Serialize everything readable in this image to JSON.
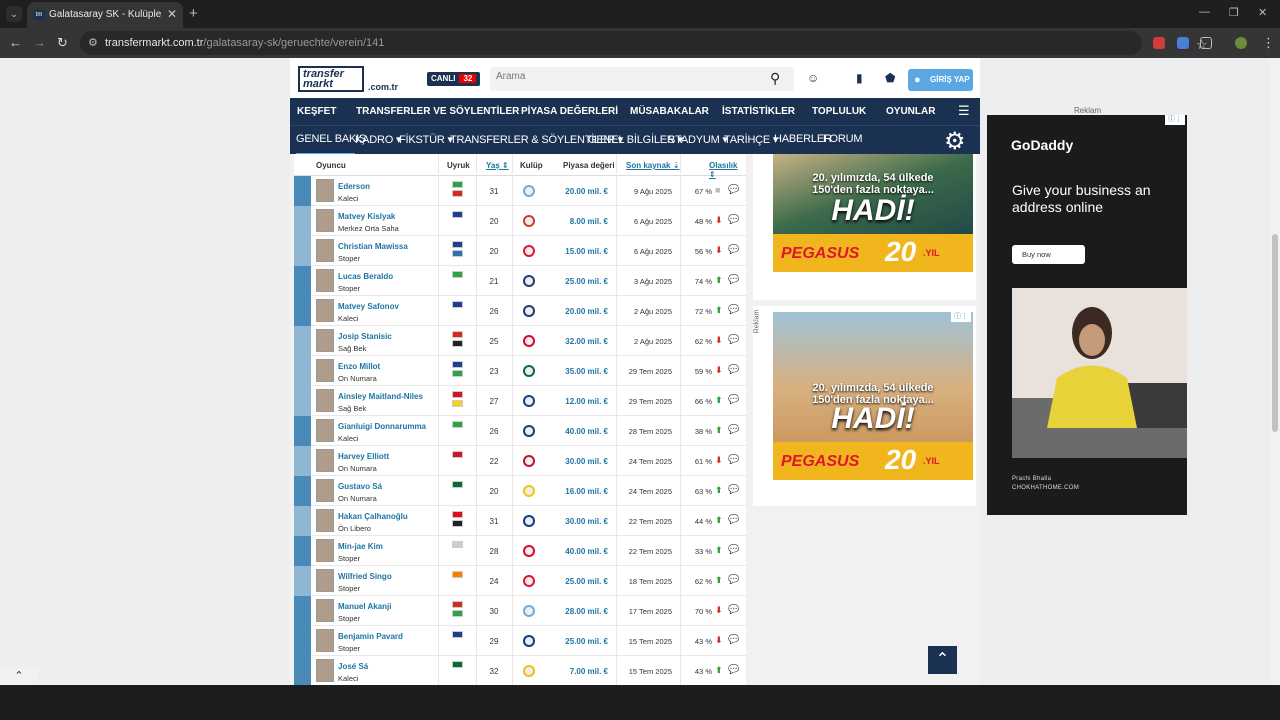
{
  "browser": {
    "tab_title": "Galatasaray SK - Kulüple ilgili tr",
    "url_domain": "transfermarkt.com.tr",
    "url_path": "/galatasaray-sk/geruechte/verein/141"
  },
  "header": {
    "logo_text": "transfer markt",
    "logo_sub": ".com.tr",
    "live_label": "CANLI",
    "live_count": "32",
    "search_placeholder": "Arama",
    "login_label": "GİRİŞ YAP"
  },
  "nav_main": [
    "KEŞFET",
    "TRANSFERLER VE SÖYLENTİLER",
    "PİYASA DEĞERLERİ",
    "MÜSABAKALAR",
    "İSTATİSTİKLER",
    "TOPLULUK",
    "OYUNLAR"
  ],
  "nav_sub": [
    "GENEL BAKIŞ",
    "KADRO ▾",
    "FİKSTÜR ▾",
    "TRANSFERLER & SÖYLENTİLER ▾",
    "GENEL BİLGİLER ▾",
    "STADYUM ▾",
    "TARİHÇE ▾",
    "HABERLER",
    "FORUM"
  ],
  "table": {
    "headers": {
      "player": "Oyuncu",
      "nationality": "Uyruk",
      "age": "Yaş ⇕",
      "club": "Kulüp",
      "market_value": "Piyasa değeri",
      "last_source": "Son kaynak ⇣",
      "probability": "Olasılık ⇕"
    },
    "rows": [
      {
        "name": "Ederson",
        "pos": "Kaleci",
        "age": "31",
        "value": "20.00 mil. €",
        "date": "9 Ağu 2025",
        "pct": "67 %",
        "trend": "■",
        "trend_color": "#bbbbbb",
        "flags": [
          "#2ba543",
          "#d52b1e"
        ],
        "bar": "#4a8ab8",
        "club_color": "#6caddf"
      },
      {
        "name": "Matvey Kislyak",
        "pos": "Merkez Orta Saha",
        "age": "20",
        "value": "8.00 mil. €",
        "date": "6 Ağu 2025",
        "pct": "48 %",
        "trend": "⬇",
        "trend_color": "#d02b2b",
        "flags": [
          "#1c3f94"
        ],
        "bar": "#8fb6d3",
        "club_color": "#d03c2c"
      },
      {
        "name": "Christian Mawissa",
        "pos": "Stoper",
        "age": "20",
        "value": "15.00 mil. €",
        "date": "6 Ağu 2025",
        "pct": "56 %",
        "trend": "⬇",
        "trend_color": "#d02b2b",
        "flags": [
          "#1c3f94",
          "#2f6fb0"
        ],
        "bar": "#8fb6d3",
        "club_color": "#e3142c"
      },
      {
        "name": "Lucas Beraldo",
        "pos": "Stoper",
        "age": "21",
        "value": "25.00 mil. €",
        "date": "3 Ağu 2025",
        "pct": "74 %",
        "trend": "⬆",
        "trend_color": "#2e9e3a",
        "flags": [
          "#2ba543"
        ],
        "bar": "#4a8ab8",
        "club_color": "#1b3c78"
      },
      {
        "name": "Matvey Safonov",
        "pos": "Kaleci",
        "age": "26",
        "value": "20.00 mil. €",
        "date": "2 Ağu 2025",
        "pct": "72 %",
        "trend": "⬆",
        "trend_color": "#2e9e3a",
        "flags": [
          "#1c3f94"
        ],
        "bar": "#4a8ab8",
        "club_color": "#1b3c78"
      },
      {
        "name": "Josip Stanisic",
        "pos": "Sağ Bek",
        "age": "25",
        "value": "32.00 mil. €",
        "date": "2 Ağu 2025",
        "pct": "62 %",
        "trend": "⬇",
        "trend_color": "#d02b2b",
        "flags": [
          "#d52b1e",
          "#222222"
        ],
        "bar": "#8fb6d3",
        "club_color": "#dc052d"
      },
      {
        "name": "Enzo Millot",
        "pos": "On Numara",
        "age": "23",
        "value": "35.00 mil. €",
        "date": "29 Tem 2025",
        "pct": "59 %",
        "trend": "⬇",
        "trend_color": "#d02b2b",
        "flags": [
          "#1c3f94",
          "#2ba543"
        ],
        "bar": "#8fb6d3",
        "club_color": "#0a6b3f"
      },
      {
        "name": "Ainsley Maitland-Niles",
        "pos": "Sağ Bek",
        "age": "27",
        "value": "12.00 mil. €",
        "date": "29 Tem 2025",
        "pct": "66 %",
        "trend": "⬆",
        "trend_color": "#2e9e3a",
        "flags": [
          "#cf142b",
          "#f7d117"
        ],
        "bar": "#8fb6d3",
        "club_color": "#1d3b8f"
      },
      {
        "name": "Gianluigi Donnarumma",
        "pos": "Kaleci",
        "age": "26",
        "value": "40.00 mil. €",
        "date": "28 Tem 2025",
        "pct": "38 %",
        "trend": "⬆",
        "trend_color": "#2e9e3a",
        "flags": [
          "#2ba543"
        ],
        "bar": "#4a8ab8",
        "club_color": "#1b3c78"
      },
      {
        "name": "Harvey Elliott",
        "pos": "On Numara",
        "age": "22",
        "value": "30.00 mil. €",
        "date": "24 Tem 2025",
        "pct": "61 %",
        "trend": "⬇",
        "trend_color": "#d02b2b",
        "flags": [
          "#cf142b"
        ],
        "bar": "#8fb6d3",
        "club_color": "#c8102e"
      },
      {
        "name": "Gustavo Sá",
        "pos": "On Numara",
        "age": "20",
        "value": "16.00 mil. €",
        "date": "24 Tem 2025",
        "pct": "63 %",
        "trend": "⬆",
        "trend_color": "#2e9e3a",
        "flags": [
          "#046a38"
        ],
        "bar": "#4a8ab8",
        "club_color": "#f1c40f"
      },
      {
        "name": "Hakan Çalhanoğlu",
        "pos": "Ön Libero",
        "age": "31",
        "value": "30.00 mil. €",
        "date": "22 Tem 2025",
        "pct": "44 %",
        "trend": "⬆",
        "trend_color": "#2e9e3a",
        "flags": [
          "#e30a17",
          "#222222"
        ],
        "bar": "#8fb6d3",
        "club_color": "#0e3a8a"
      },
      {
        "name": "Min-jae Kim",
        "pos": "Stoper",
        "age": "28",
        "value": "40.00 mil. €",
        "date": "22 Tem 2025",
        "pct": "33 %",
        "trend": "⬆",
        "trend_color": "#2e9e3a",
        "flags": [
          "#cccccc"
        ],
        "bar": "#4a8ab8",
        "club_color": "#dc052d"
      },
      {
        "name": "Wilfried Singo",
        "pos": "Stoper",
        "age": "24",
        "value": "25.00 mil. €",
        "date": "18 Tem 2025",
        "pct": "62 %",
        "trend": "⬆",
        "trend_color": "#2e9e3a",
        "flags": [
          "#f77f00"
        ],
        "bar": "#8fb6d3",
        "club_color": "#e3142c"
      },
      {
        "name": "Manuel Akanji",
        "pos": "Stoper",
        "age": "30",
        "value": "28.00 mil. €",
        "date": "17 Tem 2025",
        "pct": "70 %",
        "trend": "⬇",
        "trend_color": "#d02b2b",
        "flags": [
          "#d52b1e",
          "#2ba543"
        ],
        "bar": "#4a8ab8",
        "club_color": "#6caddf"
      },
      {
        "name": "Benjamin Pavard",
        "pos": "Stoper",
        "age": "29",
        "value": "25.00 mil. €",
        "date": "15 Tem 2025",
        "pct": "43 %",
        "trend": "⬇",
        "trend_color": "#d02b2b",
        "flags": [
          "#1c3f94"
        ],
        "bar": "#4a8ab8",
        "club_color": "#0e3a8a"
      },
      {
        "name": "José Sá",
        "pos": "Kaleci",
        "age": "32",
        "value": "7.00 mil. €",
        "date": "15 Tem 2025",
        "pct": "43 %",
        "trend": "⬆",
        "trend_color": "#2e9e3a",
        "flags": [
          "#046a38"
        ],
        "bar": "#4a8ab8",
        "club_color": "#fdb913"
      }
    ]
  },
  "ads": {
    "reklam": "Reklam",
    "pegasus_line1": "20. yılımızda, 54 ülkede",
    "pegasus_line2": "150'den fazla noktaya...",
    "pegasus_big": "HADİ!",
    "pegasus_brand": "PEGASUS",
    "pegasus_20": "20",
    "pegasus_yil": ".YIL",
    "godaddy_logo": "GoDaddy",
    "godaddy_head": "Give your business an address online",
    "godaddy_btn": "Buy now",
    "godaddy_credit1": "Prachi Bhalla",
    "godaddy_credit2": "CHOKHATHOME.COM"
  }
}
